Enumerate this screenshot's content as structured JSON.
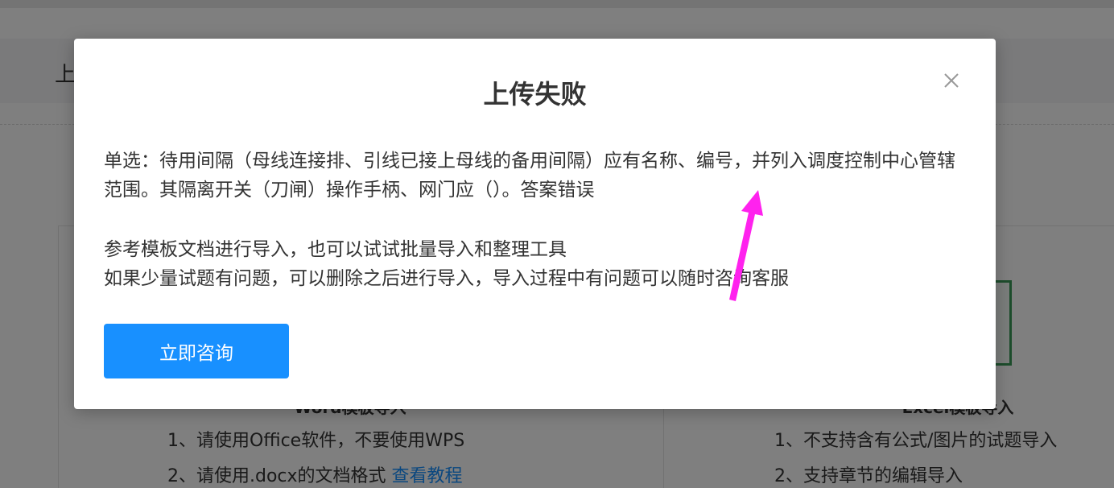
{
  "background": {
    "header_title": "上",
    "left_panel": {
      "title": "Word模板导入",
      "items": [
        "1、请使用Office软件，不要使用WPS",
        "2、请使用.docx的文档格式 "
      ],
      "link": "查看教程"
    },
    "right_panel": {
      "title": "Excel模板导入",
      "items": [
        "1、不支持含有公式/图片的试题导入",
        "2、支持章节的编辑导入"
      ]
    }
  },
  "modal": {
    "title": "上传失败",
    "error_message": "单选：待用间隔（母线连接排、引线已接上母线的备用间隔）应有名称、编号，并列入调度控制中心管辖范围。其隔离开关（刀闸）操作手柄、网门应（）。答案错误",
    "tips": [
      "参考模板文档进行导入，也可以试试批量导入和整理工具",
      "如果少量试题有问题，可以删除之后进行导入，导入过程中有问题可以随时咨询客服"
    ],
    "consult_button": "立即咨询"
  },
  "colors": {
    "primary": "#1890ff",
    "annotation_arrow": "#ff22ee",
    "overlay": "rgba(0,0,0,0.5)"
  }
}
